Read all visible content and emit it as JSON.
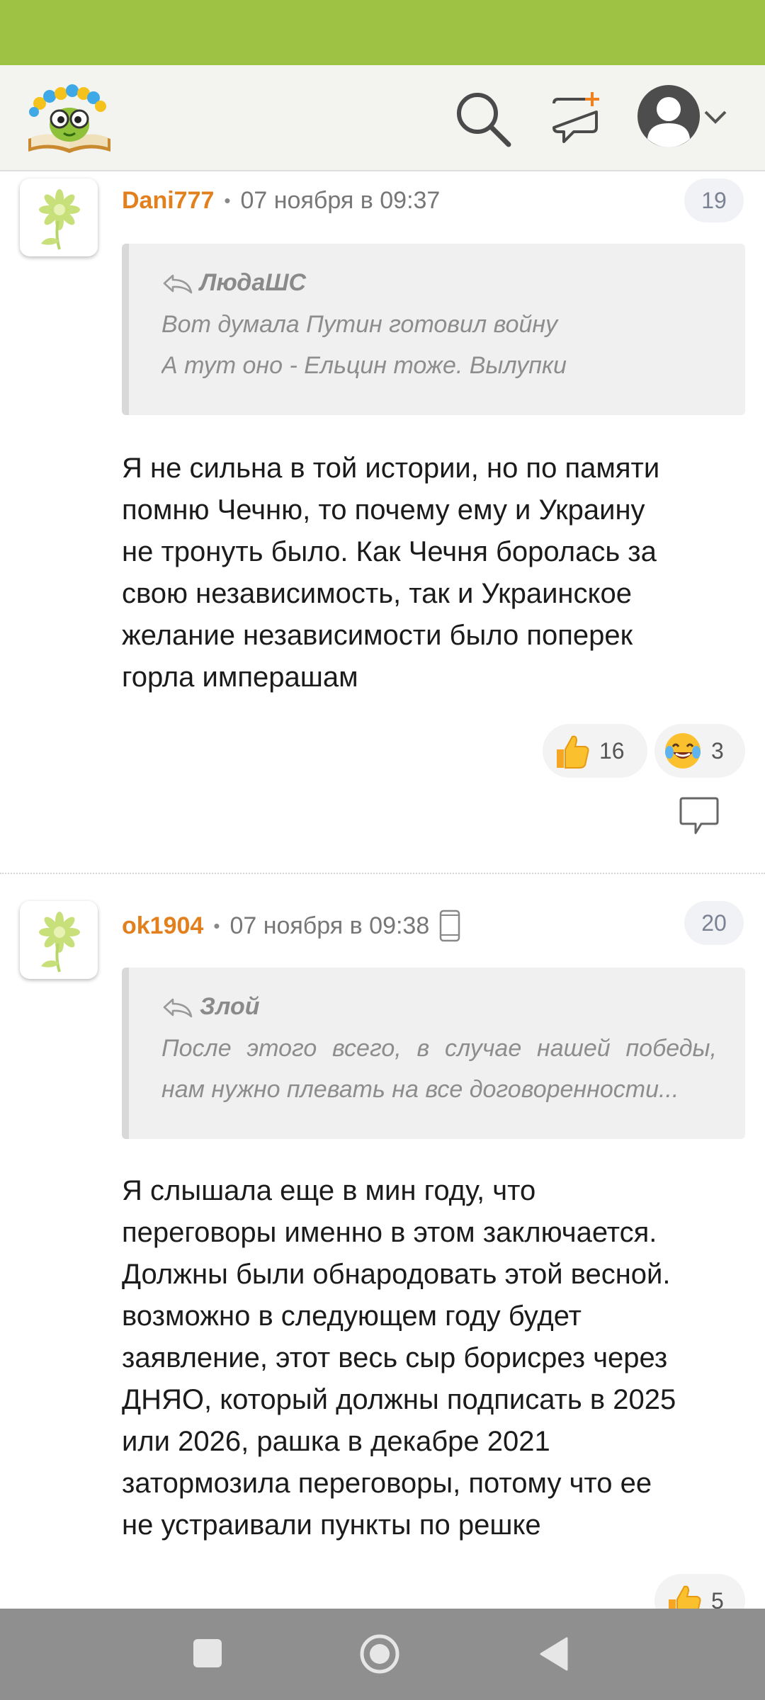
{
  "comments": [
    {
      "author": "Dani777",
      "date": "07 ноября в 09:37",
      "number": "19",
      "quote": {
        "author": "ЛюдаШС",
        "lines": [
          "Вот думала Путин готовил войну",
          "А тут оно - Ельцин тоже. Вылупки"
        ]
      },
      "text_lines": [
        "Я не сильна в той истории, но по памяти",
        "помню Чечню, то почему ему и Украину",
        "не тронуть было. Как Чечня боролась за",
        "свою независимость, так и Украинское",
        "желание независимости было поперек",
        "горла имперашам"
      ],
      "reactions": [
        {
          "icon": "thumbs-up-icon",
          "count": "16"
        },
        {
          "icon": "laughing-emoji-icon",
          "count": "3"
        }
      ]
    },
    {
      "author": "ok1904",
      "date": "07 ноября в 09:38",
      "number": "20",
      "device_icon": "mobile-phone-icon",
      "quote": {
        "author": "Злой",
        "lines": [
          "После этого всего, в случае нашей победы,",
          "нам нужно плевать на все договоренности..."
        ]
      },
      "text_lines": [
        "Я слышала еще в мин году, что",
        "переговоры именно в этом заключается.",
        "Должны были обнародовать этой весной.",
        "возможно в следующем году будет",
        "заявление, этот весь сыр борисрез через",
        "ДНЯО, который должны подписать в 2025",
        "или 2026, рашка в декабре 2021",
        "затормозила переговоры, потому что ее",
        "не устраивали пункты по решке"
      ],
      "reactions": [
        {
          "icon": "thumbs-up-icon",
          "count": "5"
        }
      ]
    }
  ],
  "colors": {
    "status_bar": "#9dc244",
    "header_bg": "#f3f3ef",
    "author": "#e2801e",
    "quote_bg": "#f0f0f0",
    "nav_bar": "#8f8f8f"
  }
}
